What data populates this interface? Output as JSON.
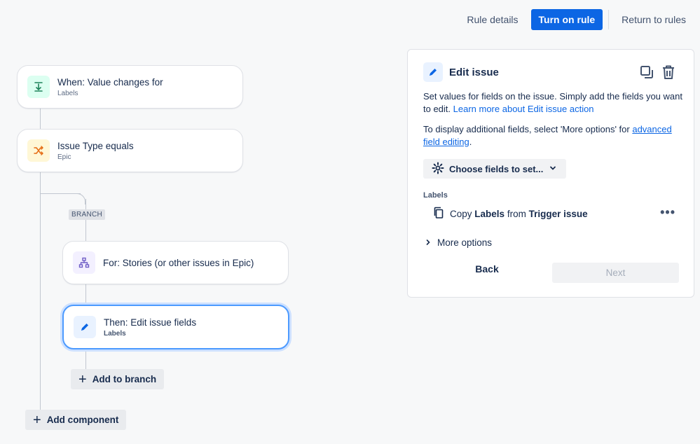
{
  "topbar": {
    "rule_details": "Rule details",
    "turn_on": "Turn on rule",
    "return": "Return to rules"
  },
  "flow": {
    "trigger": {
      "title": "When: Value changes for",
      "subtitle": "Labels"
    },
    "condition": {
      "title": "Issue Type equals",
      "subtitle": "Epic"
    },
    "branch_tag": "BRANCH",
    "branch": {
      "title": "For: Stories (or other issues in Epic)"
    },
    "action": {
      "title": "Then: Edit issue fields",
      "subtitle": "Labels"
    },
    "add_to_branch": "Add to branch",
    "add_component": "Add component"
  },
  "panel": {
    "title": "Edit issue",
    "desc1": "Set values for fields on the issue. Simply add the fields you want to edit. ",
    "desc1_link": "Learn more about Edit issue action",
    "desc2": "To display additional fields, select 'More options' for ",
    "desc2_link": "advanced field editing",
    "desc2_end": ".",
    "choose_fields": "Choose fields to set...",
    "field_label": "Labels",
    "copy_prefix": "Copy",
    "copy_field": "Labels",
    "copy_from": "from",
    "copy_source": "Trigger issue",
    "more_dots": "•••",
    "more_options": "More options",
    "back": "Back",
    "next": "Next"
  },
  "colors": {
    "primary": "#0c66e4",
    "trigger_icon_bg": "#dcfff1",
    "condition_icon_bg": "#fff7d6",
    "branch_icon_bg": "#f3f0ff",
    "action_icon_bg": "#e9f2ff"
  }
}
